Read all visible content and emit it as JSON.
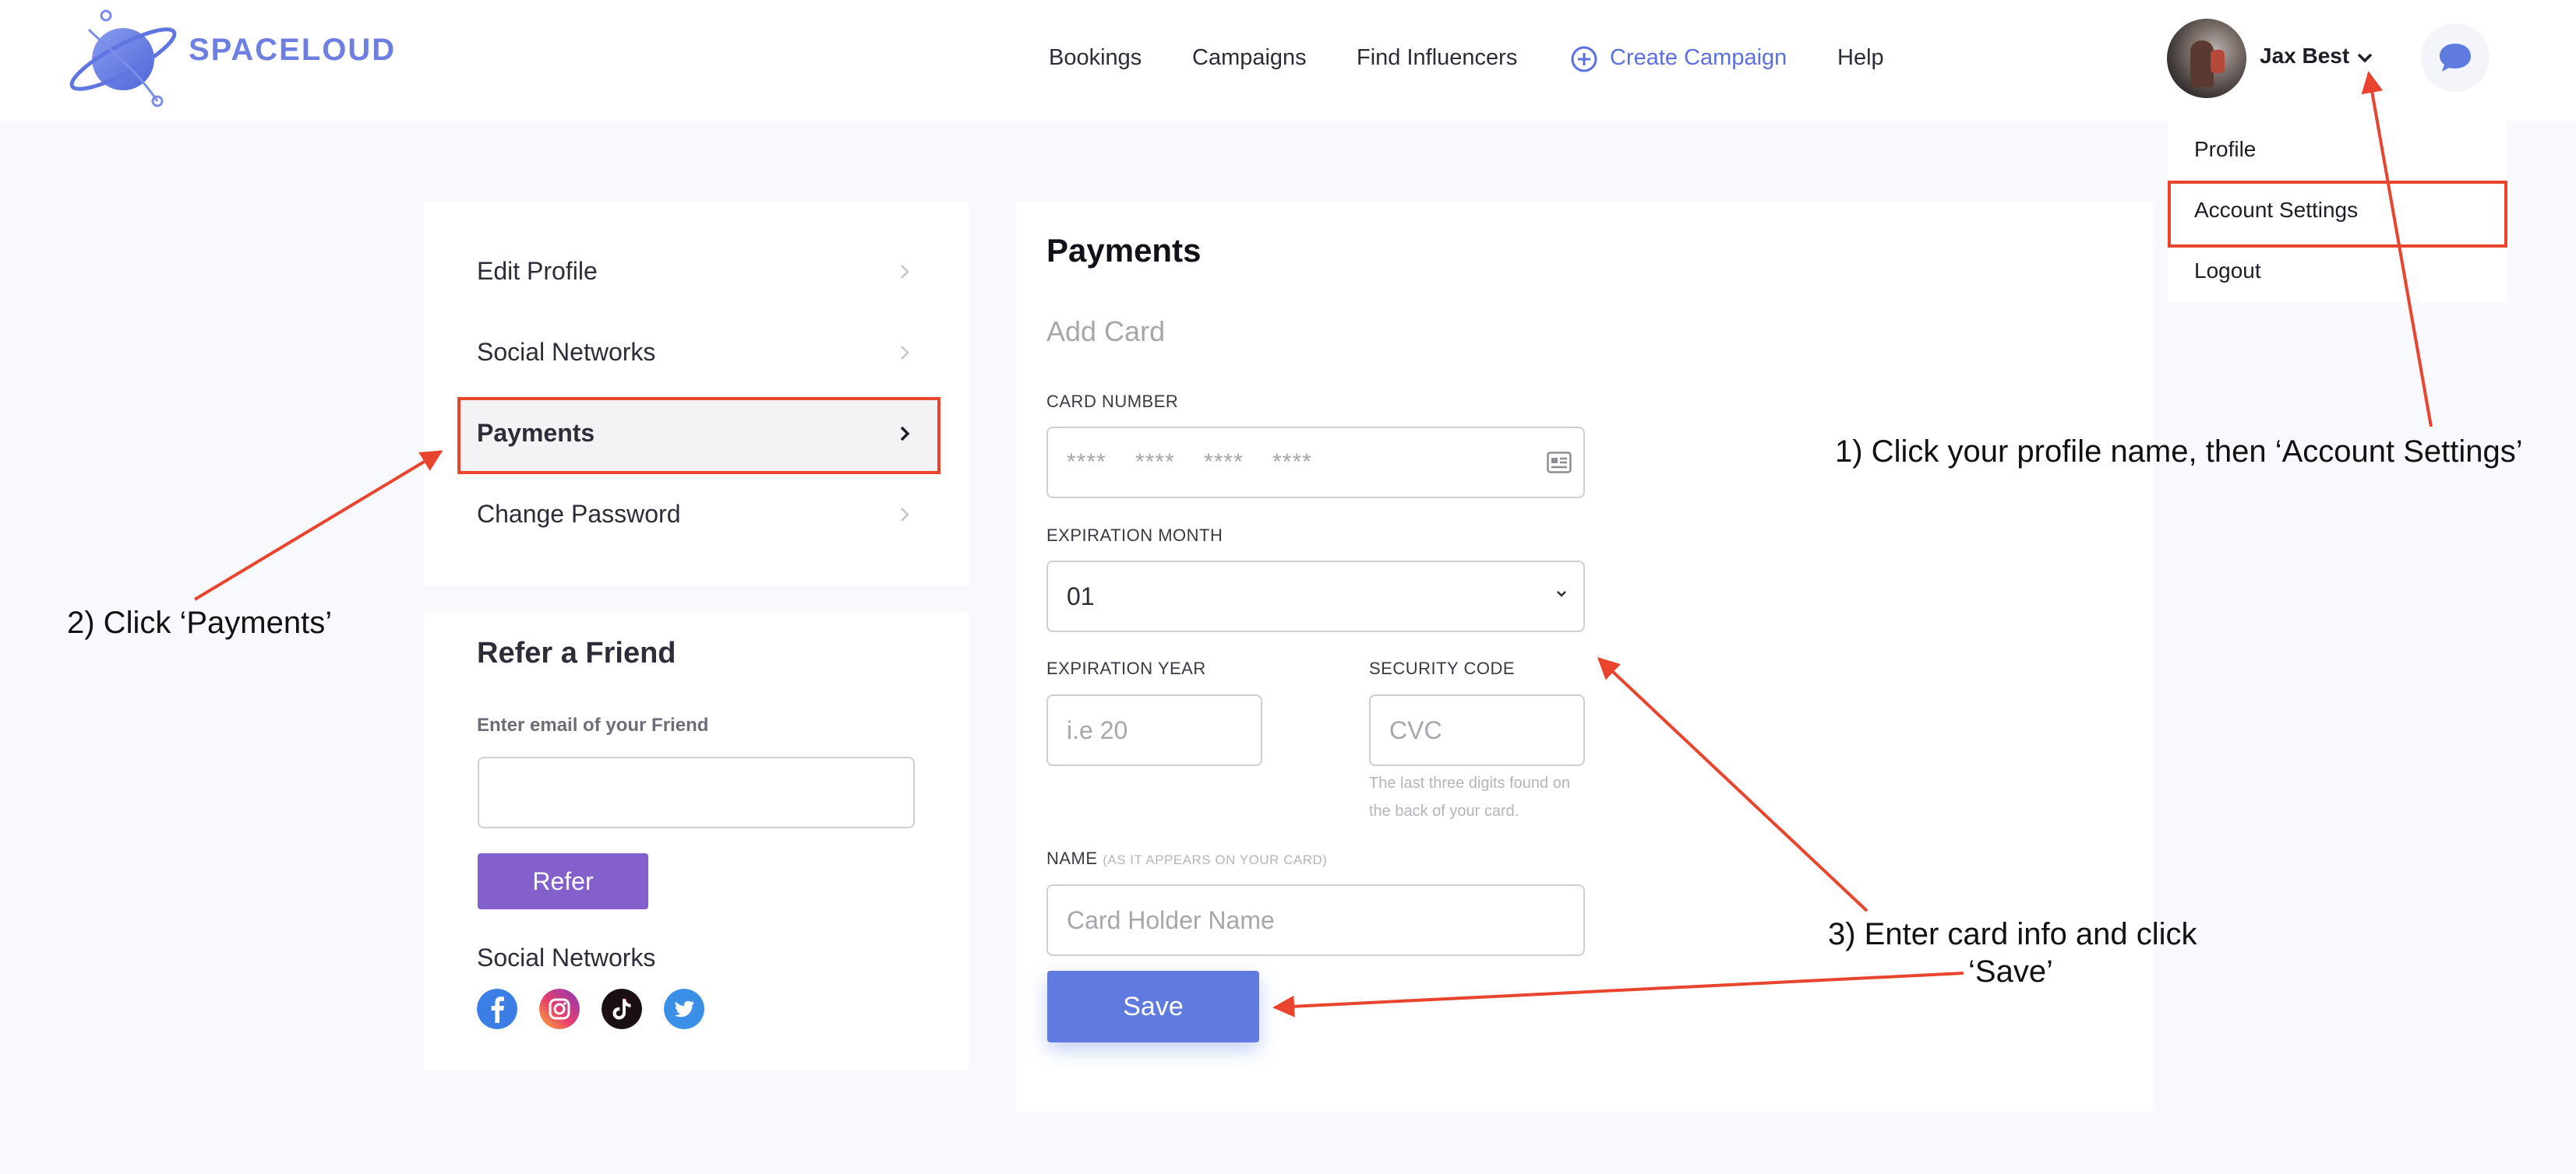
{
  "header": {
    "brand": "SPACELOUD",
    "nav": {
      "bookings": "Bookings",
      "campaigns": "Campaigns",
      "find_influencers": "Find Influencers",
      "create_campaign": "Create Campaign",
      "help": "Help"
    },
    "user_name": "Jax Best",
    "icons": {
      "logo": "planet-logo-icon",
      "create": "plus-circle-icon",
      "user_menu": "chevron-down-icon",
      "chat": "chat-bubble-icon"
    }
  },
  "user_menu": {
    "profile": "Profile",
    "account_settings": "Account Settings",
    "logout": "Logout"
  },
  "sidebar": {
    "items": [
      {
        "label": "Edit Profile",
        "active": false
      },
      {
        "label": "Social Networks",
        "active": false
      },
      {
        "label": "Payments",
        "active": true
      },
      {
        "label": "Change Password",
        "active": false
      }
    ]
  },
  "refer": {
    "title": "Refer a Friend",
    "email_label": "Enter email of your Friend",
    "email_value": "",
    "button": "Refer",
    "social_label": "Social Networks",
    "social_icons": [
      "facebook-icon",
      "instagram-icon",
      "tiktok-icon",
      "twitter-icon"
    ]
  },
  "payments": {
    "title": "Payments",
    "subtitle": "Add Card",
    "card_number_label": "CARD NUMBER",
    "card_number_placeholder": "****    ****    ****    ****",
    "exp_month_label": "EXPIRATION MONTH",
    "exp_month_value": "01",
    "exp_year_label": "EXPIRATION YEAR",
    "exp_year_placeholder": "i.e 20",
    "security_label": "SECURITY CODE",
    "security_placeholder": "CVC",
    "security_hint": "The last three digits found on the back of your card.",
    "name_label": "NAME",
    "name_sublabel": "(AS IT APPEARS ON YOUR CARD)",
    "name_placeholder": "Card Holder Name",
    "save": "Save"
  },
  "annotations": {
    "step1": "1) Click your profile name, then ‘Account Settings’",
    "step2": "2) Click ‘Payments’",
    "step3_line1": "3) Enter card info and click",
    "step3_line2": "‘Save’",
    "color": "#e8442e"
  },
  "colors": {
    "accent": "#5f7be0",
    "refer_button": "#8460cc",
    "background": "#f8f9fd"
  }
}
